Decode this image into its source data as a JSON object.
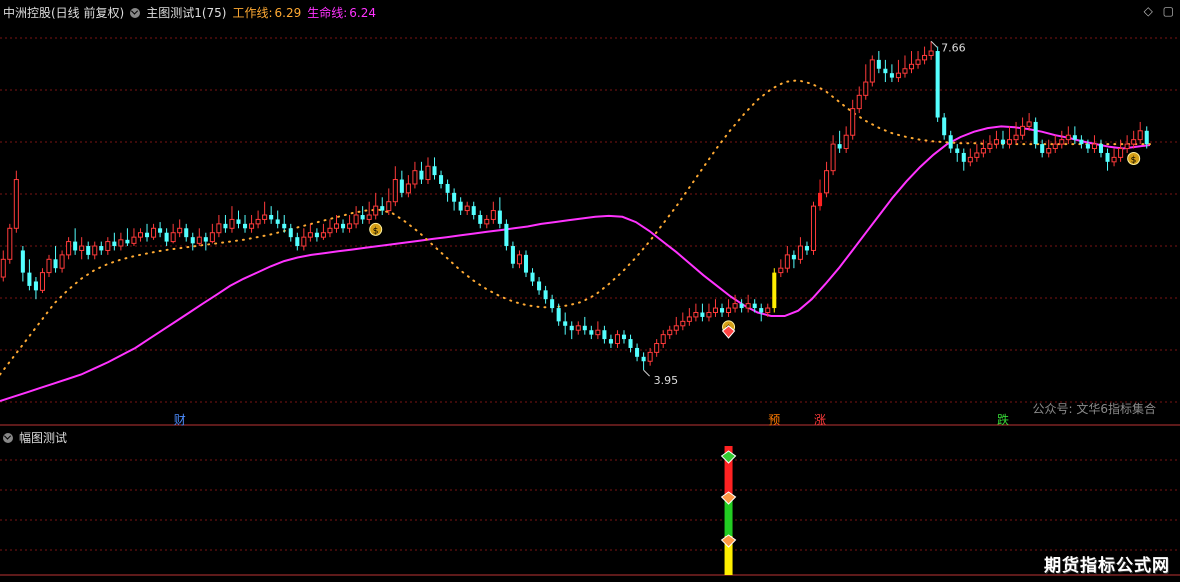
{
  "header": {
    "title": "中洲控股(日线 前复权)",
    "indicator": "主图测试1(75)",
    "work_line_label": "工作线:",
    "work_line_value": "6.29",
    "life_line_label": "生命线:",
    "life_line_value": "6.24"
  },
  "sub_panel": {
    "title": "幅图测试"
  },
  "watermark": "公众号: 文华6指标集合",
  "brand": "期货指标公式网",
  "colors": {
    "up": "#ff3b3b",
    "down": "#54ffff",
    "life_line": "#ff33ff",
    "work_line": "#ffaa33",
    "grid": "#7a1515",
    "highlight_yellow": "#ffee00",
    "highlight_red": "#ff2222"
  },
  "icons": [
    "dropdown-circle-icon",
    "diamond-icon",
    "restore-icon",
    "money-bag-icon",
    "triangle-icon"
  ],
  "chart_data": {
    "type": "candlestick",
    "price_range": [
      3.5,
      7.9
    ],
    "high_label": "7.66",
    "low_label": "3.95",
    "markers": [
      {
        "label": "财",
        "bar": 27,
        "color": "#4d8dff"
      },
      {
        "label": "预",
        "bar": 118,
        "color": "#ff7a00"
      },
      {
        "label": "涨",
        "bar": 125,
        "color": "#ff3b3b"
      },
      {
        "label": "跌",
        "bar": 153,
        "color": "#36d836"
      }
    ],
    "bars": [
      [
        5.0,
        5.2,
        5.3,
        4.95
      ],
      [
        5.2,
        5.55,
        5.6,
        5.15
      ],
      [
        5.55,
        6.1,
        6.2,
        5.5
      ],
      [
        5.3,
        5.05,
        5.35,
        4.95
      ],
      [
        5.05,
        4.9,
        5.2,
        4.85
      ],
      [
        4.95,
        4.85,
        5.0,
        4.75
      ],
      [
        4.85,
        5.05,
        5.1,
        4.82
      ],
      [
        5.05,
        5.2,
        5.25,
        5.0
      ],
      [
        5.2,
        5.1,
        5.35,
        5.05
      ],
      [
        5.1,
        5.25,
        5.3,
        5.05
      ],
      [
        5.25,
        5.4,
        5.45,
        5.2
      ],
      [
        5.4,
        5.3,
        5.55,
        5.25
      ],
      [
        5.3,
        5.35,
        5.45,
        5.2
      ],
      [
        5.35,
        5.25,
        5.4,
        5.2
      ],
      [
        5.25,
        5.35,
        5.4,
        5.2
      ],
      [
        5.35,
        5.3,
        5.4,
        5.25
      ],
      [
        5.3,
        5.4,
        5.45,
        5.25
      ],
      [
        5.4,
        5.35,
        5.5,
        5.3
      ],
      [
        5.35,
        5.42,
        5.5,
        5.3
      ],
      [
        5.42,
        5.38,
        5.55,
        5.35
      ],
      [
        5.38,
        5.45,
        5.55,
        5.35
      ],
      [
        5.45,
        5.5,
        5.55,
        5.4
      ],
      [
        5.5,
        5.45,
        5.6,
        5.4
      ],
      [
        5.45,
        5.55,
        5.6,
        5.42
      ],
      [
        5.55,
        5.5,
        5.62,
        5.45
      ],
      [
        5.5,
        5.4,
        5.55,
        5.35
      ],
      [
        5.4,
        5.5,
        5.6,
        5.38
      ],
      [
        5.5,
        5.55,
        5.65,
        5.45
      ],
      [
        5.55,
        5.45,
        5.6,
        5.4
      ],
      [
        5.45,
        5.38,
        5.5,
        5.3
      ],
      [
        5.38,
        5.45,
        5.55,
        5.35
      ],
      [
        5.45,
        5.4,
        5.5,
        5.3
      ],
      [
        5.4,
        5.5,
        5.6,
        5.38
      ],
      [
        5.5,
        5.6,
        5.7,
        5.45
      ],
      [
        5.6,
        5.55,
        5.7,
        5.5
      ],
      [
        5.55,
        5.65,
        5.8,
        5.5
      ],
      [
        5.65,
        5.6,
        5.75,
        5.55
      ],
      [
        5.6,
        5.55,
        5.7,
        5.5
      ],
      [
        5.55,
        5.6,
        5.7,
        5.5
      ],
      [
        5.6,
        5.65,
        5.75,
        5.55
      ],
      [
        5.65,
        5.7,
        5.85,
        5.6
      ],
      [
        5.7,
        5.65,
        5.8,
        5.6
      ],
      [
        5.65,
        5.6,
        5.75,
        5.55
      ],
      [
        5.6,
        5.55,
        5.7,
        5.5
      ],
      [
        5.55,
        5.45,
        5.6,
        5.4
      ],
      [
        5.45,
        5.35,
        5.5,
        5.3
      ],
      [
        5.35,
        5.45,
        5.55,
        5.3
      ],
      [
        5.45,
        5.5,
        5.6,
        5.4
      ],
      [
        5.5,
        5.45,
        5.55,
        5.4
      ],
      [
        5.45,
        5.5,
        5.6,
        5.42
      ],
      [
        5.5,
        5.55,
        5.65,
        5.45
      ],
      [
        5.55,
        5.6,
        5.7,
        5.5
      ],
      [
        5.6,
        5.55,
        5.65,
        5.5
      ],
      [
        5.55,
        5.6,
        5.7,
        5.5
      ],
      [
        5.6,
        5.7,
        5.8,
        5.55
      ],
      [
        5.7,
        5.65,
        5.8,
        5.6
      ],
      [
        5.65,
        5.7,
        5.85,
        5.6
      ],
      [
        5.7,
        5.8,
        5.95,
        5.65
      ],
      [
        5.8,
        5.75,
        5.9,
        5.7
      ],
      [
        5.75,
        5.85,
        6.0,
        5.7
      ],
      [
        5.85,
        6.1,
        6.25,
        5.8
      ],
      [
        6.1,
        5.95,
        6.2,
        5.9
      ],
      [
        5.95,
        6.05,
        6.15,
        5.9
      ],
      [
        6.05,
        6.2,
        6.3,
        6.0
      ],
      [
        6.2,
        6.1,
        6.3,
        6.05
      ],
      [
        6.1,
        6.25,
        6.35,
        6.05
      ],
      [
        6.25,
        6.15,
        6.35,
        6.1
      ],
      [
        6.15,
        6.05,
        6.2,
        6.0
      ],
      [
        6.05,
        5.95,
        6.1,
        5.85
      ],
      [
        5.95,
        5.85,
        6.0,
        5.75
      ],
      [
        5.85,
        5.75,
        5.9,
        5.7
      ],
      [
        5.75,
        5.8,
        5.85,
        5.7
      ],
      [
        5.8,
        5.7,
        5.85,
        5.65
      ],
      [
        5.7,
        5.6,
        5.75,
        5.55
      ],
      [
        5.6,
        5.65,
        5.7,
        5.55
      ],
      [
        5.65,
        5.75,
        5.85,
        5.6
      ],
      [
        5.75,
        5.6,
        5.9,
        5.55
      ],
      [
        5.6,
        5.35,
        5.65,
        5.3
      ],
      [
        5.35,
        5.15,
        5.4,
        5.1
      ],
      [
        5.15,
        5.25,
        5.3,
        5.1
      ],
      [
        5.25,
        5.05,
        5.3,
        5.0
      ],
      [
        5.05,
        4.95,
        5.1,
        4.9
      ],
      [
        4.95,
        4.85,
        5.0,
        4.8
      ],
      [
        4.85,
        4.75,
        4.9,
        4.7
      ],
      [
        4.75,
        4.65,
        4.8,
        4.6
      ],
      [
        4.65,
        4.5,
        4.7,
        4.45
      ],
      [
        4.5,
        4.45,
        4.6,
        4.35
      ],
      [
        4.45,
        4.4,
        4.5,
        4.3
      ],
      [
        4.4,
        4.45,
        4.5,
        4.35
      ],
      [
        4.45,
        4.4,
        4.55,
        4.35
      ],
      [
        4.4,
        4.35,
        4.45,
        4.3
      ],
      [
        4.35,
        4.4,
        4.5,
        4.3
      ],
      [
        4.4,
        4.3,
        4.45,
        4.25
      ],
      [
        4.3,
        4.25,
        4.35,
        4.2
      ],
      [
        4.25,
        4.35,
        4.4,
        4.2
      ],
      [
        4.35,
        4.3,
        4.4,
        4.25
      ],
      [
        4.3,
        4.2,
        4.35,
        4.15
      ],
      [
        4.2,
        4.1,
        4.25,
        4.05
      ],
      [
        4.1,
        4.05,
        4.15,
        3.95
      ],
      [
        4.05,
        4.15,
        4.2,
        4.0
      ],
      [
        4.15,
        4.25,
        4.3,
        4.1
      ],
      [
        4.25,
        4.35,
        4.4,
        4.2
      ],
      [
        4.35,
        4.4,
        4.45,
        4.3
      ],
      [
        4.4,
        4.45,
        4.55,
        4.35
      ],
      [
        4.45,
        4.5,
        4.6,
        4.4
      ],
      [
        4.5,
        4.55,
        4.65,
        4.45
      ],
      [
        4.55,
        4.6,
        4.7,
        4.5
      ],
      [
        4.6,
        4.55,
        4.7,
        4.5
      ],
      [
        4.55,
        4.6,
        4.7,
        4.5
      ],
      [
        4.6,
        4.65,
        4.75,
        4.55
      ],
      [
        4.65,
        4.6,
        4.7,
        4.55
      ],
      [
        4.6,
        4.65,
        4.75,
        4.55
      ],
      [
        4.65,
        4.7,
        4.8,
        4.6
      ],
      [
        4.7,
        4.65,
        4.75,
        4.6
      ],
      [
        4.65,
        4.7,
        4.8,
        4.6
      ],
      [
        4.7,
        4.65,
        4.75,
        4.6
      ],
      [
        4.65,
        4.6,
        4.7,
        4.5
      ],
      [
        4.6,
        4.65,
        4.7,
        4.55
      ],
      [
        4.65,
        5.05,
        5.1,
        4.6
      ],
      [
        5.05,
        5.1,
        5.2,
        5.0
      ],
      [
        5.1,
        5.25,
        5.35,
        5.05
      ],
      [
        5.25,
        5.2,
        5.3,
        5.1
      ],
      [
        5.2,
        5.35,
        5.45,
        5.15
      ],
      [
        5.35,
        5.3,
        5.4,
        5.25
      ],
      [
        5.3,
        5.8,
        5.85,
        5.25
      ],
      [
        5.8,
        5.95,
        6.1,
        5.75
      ],
      [
        5.95,
        6.2,
        6.3,
        5.9
      ],
      [
        6.2,
        6.5,
        6.6,
        6.15
      ],
      [
        6.5,
        6.45,
        6.65,
        6.4
      ],
      [
        6.45,
        6.6,
        6.7,
        6.4
      ],
      [
        6.6,
        6.9,
        7.0,
        6.55
      ],
      [
        6.9,
        7.05,
        7.15,
        6.85
      ],
      [
        7.05,
        7.2,
        7.4,
        7.0
      ],
      [
        7.2,
        7.45,
        7.5,
        7.15
      ],
      [
        7.45,
        7.35,
        7.55,
        7.3
      ],
      [
        7.35,
        7.3,
        7.45,
        7.2
      ],
      [
        7.3,
        7.25,
        7.4,
        7.2
      ],
      [
        7.25,
        7.3,
        7.45,
        7.2
      ],
      [
        7.3,
        7.35,
        7.5,
        7.25
      ],
      [
        7.35,
        7.4,
        7.55,
        7.3
      ],
      [
        7.4,
        7.45,
        7.55,
        7.35
      ],
      [
        7.45,
        7.5,
        7.6,
        7.4
      ],
      [
        7.5,
        7.55,
        7.66,
        7.45
      ],
      [
        7.55,
        6.8,
        7.6,
        6.75
      ],
      [
        6.8,
        6.6,
        6.85,
        6.55
      ],
      [
        6.6,
        6.45,
        6.65,
        6.4
      ],
      [
        6.45,
        6.4,
        6.5,
        6.3
      ],
      [
        6.4,
        6.3,
        6.45,
        6.2
      ],
      [
        6.3,
        6.35,
        6.45,
        6.25
      ],
      [
        6.35,
        6.4,
        6.5,
        6.3
      ],
      [
        6.4,
        6.45,
        6.55,
        6.35
      ],
      [
        6.45,
        6.5,
        6.6,
        6.4
      ],
      [
        6.5,
        6.55,
        6.65,
        6.45
      ],
      [
        6.55,
        6.5,
        6.65,
        6.45
      ],
      [
        6.5,
        6.55,
        6.7,
        6.45
      ],
      [
        6.55,
        6.6,
        6.75,
        6.5
      ],
      [
        6.6,
        6.7,
        6.8,
        6.55
      ],
      [
        6.7,
        6.75,
        6.85,
        6.65
      ],
      [
        6.75,
        6.5,
        6.8,
        6.45
      ],
      [
        6.5,
        6.4,
        6.55,
        6.35
      ],
      [
        6.4,
        6.45,
        6.55,
        6.35
      ],
      [
        6.45,
        6.5,
        6.6,
        6.4
      ],
      [
        6.5,
        6.55,
        6.65,
        6.45
      ],
      [
        6.55,
        6.6,
        6.7,
        6.5
      ],
      [
        6.6,
        6.55,
        6.7,
        6.5
      ],
      [
        6.55,
        6.5,
        6.6,
        6.45
      ],
      [
        6.5,
        6.45,
        6.55,
        6.4
      ],
      [
        6.45,
        6.5,
        6.6,
        6.4
      ],
      [
        6.5,
        6.4,
        6.55,
        6.35
      ],
      [
        6.4,
        6.3,
        6.45,
        6.2
      ],
      [
        6.3,
        6.35,
        6.45,
        6.25
      ],
      [
        6.35,
        6.45,
        6.55,
        6.3
      ],
      [
        6.45,
        6.5,
        6.6,
        6.4
      ],
      [
        6.5,
        6.55,
        6.65,
        6.45
      ],
      [
        6.55,
        6.65,
        6.75,
        6.5
      ],
      [
        6.65,
        6.5,
        6.7,
        6.45
      ]
    ],
    "life_line": [
      3.6,
      3.65,
      3.7,
      3.75,
      3.8,
      3.85,
      3.9,
      3.97,
      4.04,
      4.12,
      4.2,
      4.3,
      4.4,
      4.5,
      4.6,
      4.7,
      4.8,
      4.9,
      4.98,
      5.05,
      5.12,
      5.18,
      5.22,
      5.25,
      5.27,
      5.29,
      5.31,
      5.33,
      5.35,
      5.37,
      5.39,
      5.41,
      5.43,
      5.45,
      5.47,
      5.49,
      5.51,
      5.53,
      5.55,
      5.57,
      5.6,
      5.62,
      5.64,
      5.66,
      5.68,
      5.69,
      5.68,
      5.62,
      5.52,
      5.4,
      5.28,
      5.15,
      5.02,
      4.9,
      4.78,
      4.68,
      4.6,
      4.56,
      4.56,
      4.62,
      4.75,
      4.92,
      5.1,
      5.3,
      5.5,
      5.7,
      5.9,
      6.08,
      6.24,
      6.38,
      6.5,
      6.58,
      6.64,
      6.68,
      6.7,
      6.69,
      6.67,
      6.64,
      6.6,
      6.57,
      6.53,
      6.5,
      6.47,
      6.45,
      6.47,
      6.49
    ],
    "work_line": [
      3.9,
      4.1,
      4.3,
      4.5,
      4.7,
      4.85,
      4.98,
      5.08,
      5.15,
      5.2,
      5.24,
      5.27,
      5.3,
      5.32,
      5.34,
      5.36,
      5.38,
      5.4,
      5.42,
      5.45,
      5.48,
      5.52,
      5.56,
      5.6,
      5.64,
      5.68,
      5.72,
      5.75,
      5.76,
      5.72,
      5.62,
      5.5,
      5.36,
      5.22,
      5.08,
      4.96,
      4.86,
      4.78,
      4.72,
      4.68,
      4.66,
      4.66,
      4.68,
      4.72,
      4.8,
      4.92,
      5.06,
      5.22,
      5.4,
      5.6,
      5.8,
      6.02,
      6.24,
      6.46,
      6.66,
      6.84,
      7.0,
      7.12,
      7.2,
      7.22,
      7.18,
      7.1,
      6.98,
      6.86,
      6.76,
      6.68,
      6.62,
      6.58,
      6.55,
      6.53,
      6.52,
      6.51,
      6.51,
      6.5,
      6.5,
      6.5,
      6.5,
      6.5,
      6.5,
      6.5,
      6.5,
      6.5,
      6.5,
      6.5,
      6.5,
      6.5
    ]
  }
}
